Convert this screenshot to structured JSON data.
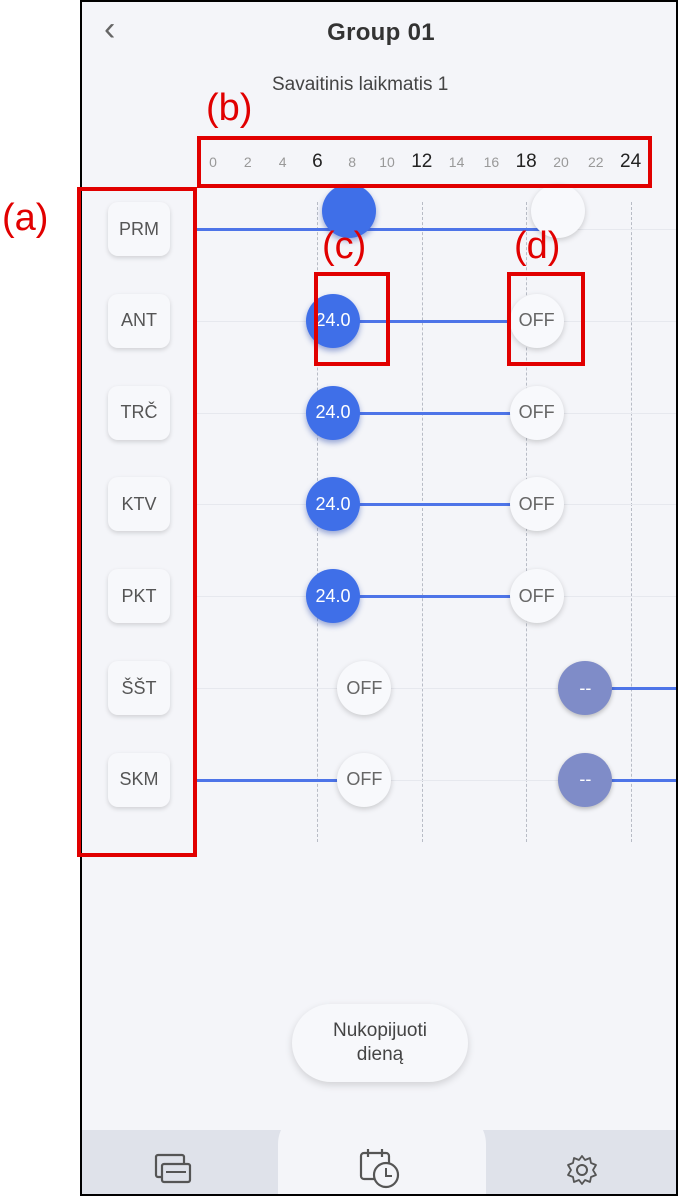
{
  "header": {
    "back_icon": "chevron-left-icon",
    "title": "Group 01",
    "subtitle": "Savaitinis laikmatis 1"
  },
  "timeline": {
    "ticks": [
      {
        "label": "0",
        "major": false
      },
      {
        "label": "2",
        "major": false
      },
      {
        "label": "4",
        "major": false
      },
      {
        "label": "6",
        "major": true
      },
      {
        "label": "8",
        "major": false
      },
      {
        "label": "10",
        "major": false
      },
      {
        "label": "12",
        "major": true
      },
      {
        "label": "14",
        "major": false
      },
      {
        "label": "16",
        "major": false
      },
      {
        "label": "18",
        "major": true
      },
      {
        "label": "20",
        "major": false
      },
      {
        "label": "22",
        "major": false
      },
      {
        "label": "24",
        "major": true
      }
    ]
  },
  "days": [
    {
      "label": "PRM",
      "nodes": [
        {
          "hour": 7.8,
          "text": "",
          "kind": "blue"
        },
        {
          "hour": 19.8,
          "text": "",
          "kind": "off"
        }
      ],
      "segments": [
        [
          0,
          19.8
        ]
      ]
    },
    {
      "label": "ANT",
      "nodes": [
        {
          "hour": 6.9,
          "text": "24.0",
          "kind": "blue"
        },
        {
          "hour": 18.6,
          "text": "OFF",
          "kind": "off"
        }
      ],
      "segments": [
        [
          6.9,
          18.6
        ]
      ]
    },
    {
      "label": "TRČ",
      "nodes": [
        {
          "hour": 6.9,
          "text": "24.0",
          "kind": "blue"
        },
        {
          "hour": 18.6,
          "text": "OFF",
          "kind": "off"
        }
      ],
      "segments": [
        [
          6.9,
          18.6
        ]
      ]
    },
    {
      "label": "KTV",
      "nodes": [
        {
          "hour": 6.9,
          "text": "24.0",
          "kind": "blue"
        },
        {
          "hour": 18.6,
          "text": "OFF",
          "kind": "off"
        }
      ],
      "segments": [
        [
          6.9,
          18.6
        ]
      ]
    },
    {
      "label": "PKT",
      "nodes": [
        {
          "hour": 6.9,
          "text": "24.0",
          "kind": "blue"
        },
        {
          "hour": 18.6,
          "text": "OFF",
          "kind": "off"
        }
      ],
      "segments": [
        [
          6.9,
          18.6
        ]
      ]
    },
    {
      "label": "ŠŠT",
      "nodes": [
        {
          "hour": 8.7,
          "text": "OFF",
          "kind": "off"
        },
        {
          "hour": 21.4,
          "text": "--",
          "kind": "slate"
        }
      ],
      "segments": [
        [
          21.4,
          24
        ]
      ]
    },
    {
      "label": "SKM",
      "nodes": [
        {
          "hour": 8.7,
          "text": "OFF",
          "kind": "off"
        },
        {
          "hour": 21.4,
          "text": "--",
          "kind": "slate"
        }
      ],
      "segments": [
        [
          0,
          8.7
        ],
        [
          21.4,
          24
        ]
      ]
    }
  ],
  "copy_button": {
    "label": "Nukopijuoti\ndieną"
  },
  "navbar": {
    "items": [
      {
        "icon": "devices-icon"
      },
      {
        "icon": "timer-calendar-icon"
      },
      {
        "icon": "gear-icon"
      }
    ]
  },
  "annotations": {
    "a": "(a)",
    "b": "(b)",
    "c": "(c)",
    "d": "(d)"
  },
  "colors": {
    "accent": "#3f6fe8",
    "slate": "#7f8cc8",
    "annotation": "#e10000"
  }
}
